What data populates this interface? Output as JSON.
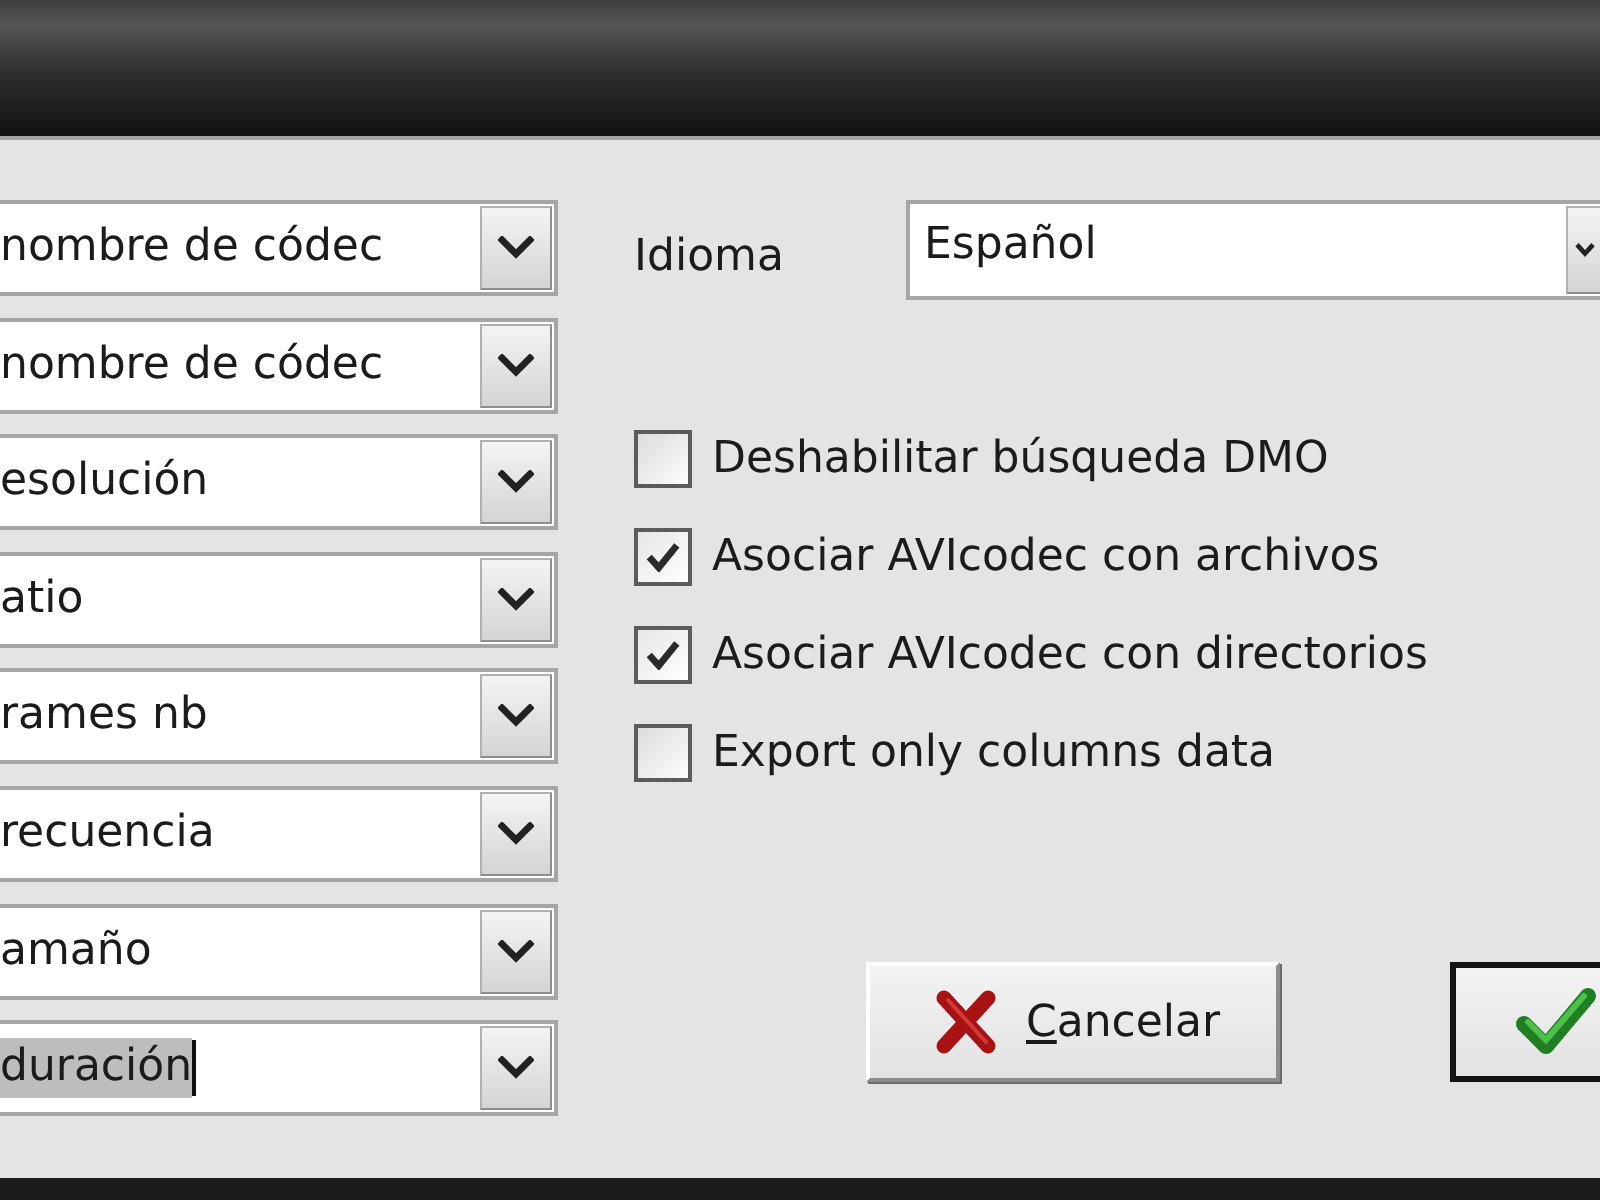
{
  "column_fields": [
    {
      "value": "nombre de códec",
      "focused": false
    },
    {
      "value": "nombre de códec",
      "focused": false
    },
    {
      "value": "esolución",
      "focused": false
    },
    {
      "value": "atio",
      "focused": false
    },
    {
      "value": "rames nb",
      "focused": false
    },
    {
      "value": "recuencia",
      "focused": false
    },
    {
      "value": "amaño",
      "focused": false
    },
    {
      "value": "duración",
      "focused": true
    }
  ],
  "language": {
    "label": "Idioma",
    "value": "Español"
  },
  "options": [
    {
      "label": "Deshabilitar búsqueda DMO",
      "checked": false
    },
    {
      "label": "Asociar AVIcodec con archivos",
      "checked": true
    },
    {
      "label": "Asociar AVIcodec con directorios",
      "checked": true
    },
    {
      "label": "Export only columns data",
      "checked": false
    }
  ],
  "buttons": [
    {
      "kind": "cancel",
      "label": "Cancelar",
      "mnemonic_underlined": true,
      "default": false
    },
    {
      "kind": "ok",
      "default": true
    }
  ]
}
